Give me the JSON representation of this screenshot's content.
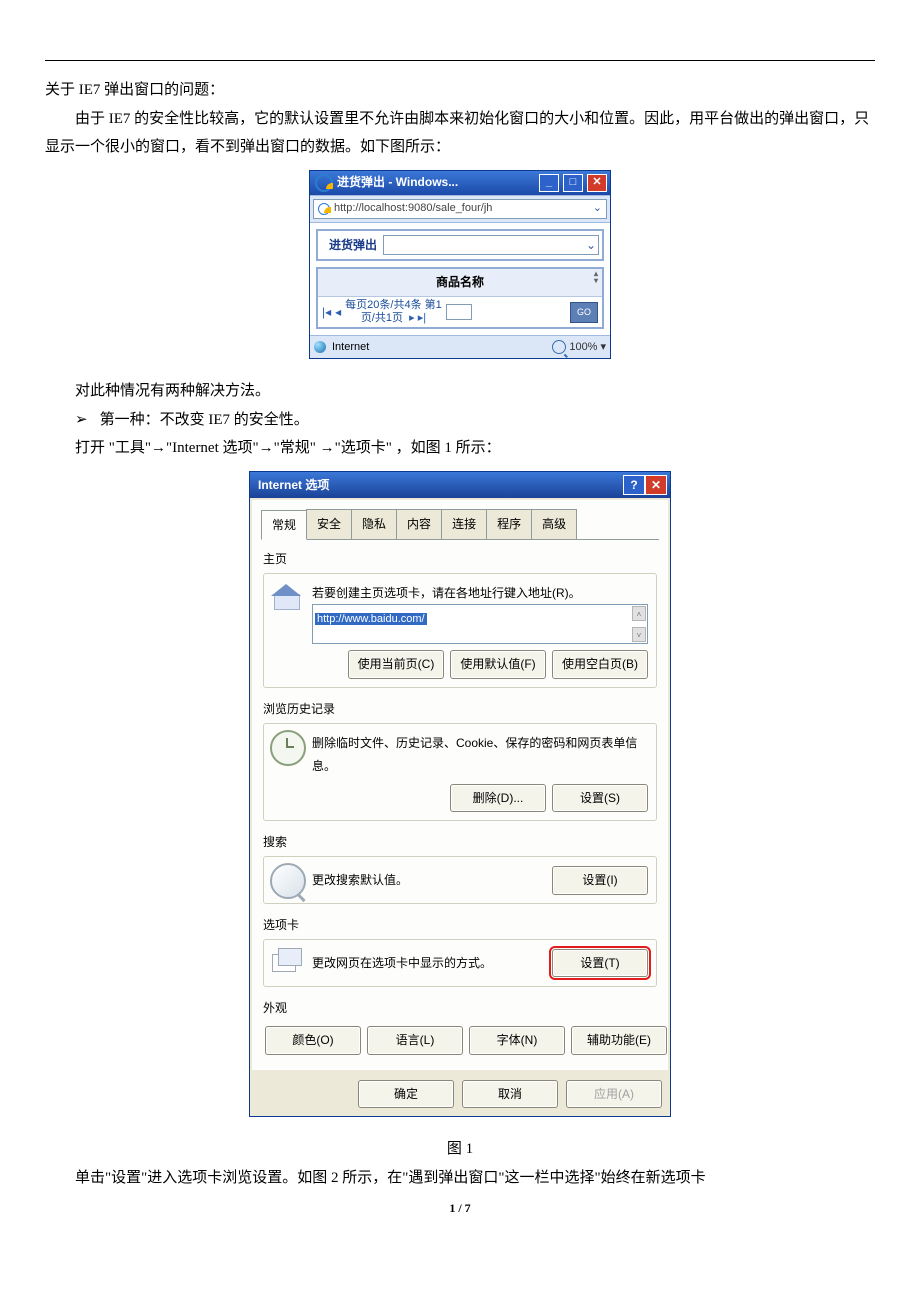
{
  "doc": {
    "p1": "关于 IE7 弹出窗口的问题：",
    "p2": "由于 IE7 的安全性比较高，它的默认设置里不允许由脚本来初始化窗口的大小和位置。因此，用平台做出的弹出窗口，只显示一个很小的窗口，看不到弹出窗口的数据。如下图所示：",
    "p3": "对此种情况有两种解决方法。",
    "bullet1": "第一种：不改变 IE7 的安全性。",
    "p4": "打开 \"工具\"→\"Internet 选项\"→\"常规\" →\"选项卡\" ，如图 1 所示：",
    "fig1": "图 1",
    "p5": "单击\"设置\"进入选项卡浏览设置。如图 2 所示，在\"遇到弹出窗口\"这一栏中选择\"始终在新选项卡",
    "pagenum": "1 / 7"
  },
  "ieSmall": {
    "title": "进货弹出 - Windows...",
    "address": "http://localhost:9080/sale_four/jh",
    "searchLabel": "进货弹出",
    "tableHeader": "商品名称",
    "pagerLine1": "每页20条/共4条  第1",
    "pagerLine2": "页/共1页",
    "go": "GO",
    "statusZone": "Internet",
    "zoom": "100%"
  },
  "opt": {
    "title": "Internet 选项",
    "tabs": [
      "常规",
      "安全",
      "隐私",
      "内容",
      "连接",
      "程序",
      "高级"
    ],
    "home": {
      "label": "主页",
      "desc": "若要创建主页选项卡，请在各地址行键入地址(R)。",
      "url": "http://www.baidu.com/",
      "btns": [
        "使用当前页(C)",
        "使用默认值(F)",
        "使用空白页(B)"
      ]
    },
    "history": {
      "label": "浏览历史记录",
      "desc": "删除临时文件、历史记录、Cookie、保存的密码和网页表单信息。",
      "btns": [
        "删除(D)...",
        "设置(S)"
      ]
    },
    "search": {
      "label": "搜索",
      "desc": "更改搜索默认值。",
      "btn": "设置(I)"
    },
    "tabsSection": {
      "label": "选项卡",
      "desc": "更改网页在选项卡中显示的方式。",
      "btn": "设置(T)"
    },
    "appearance": {
      "label": "外观",
      "btns": [
        "颜色(O)",
        "语言(L)",
        "字体(N)",
        "辅助功能(E)"
      ]
    },
    "bottom": {
      "ok": "确定",
      "cancel": "取消",
      "apply": "应用(A)"
    }
  }
}
